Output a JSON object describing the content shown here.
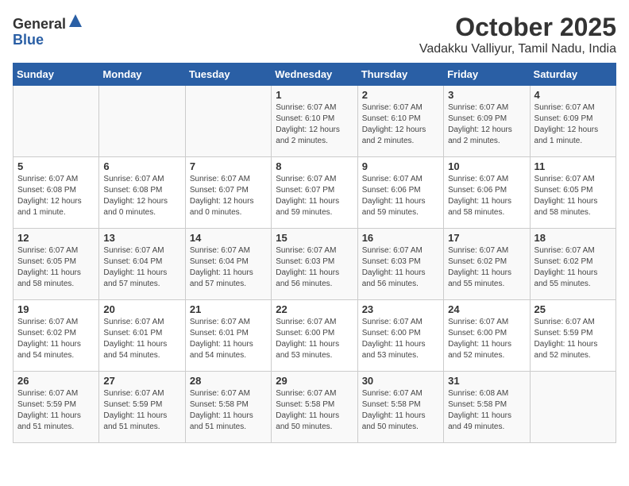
{
  "header": {
    "logo_general": "General",
    "logo_blue": "Blue",
    "title": "October 2025",
    "subtitle": "Vadakku Valliyur, Tamil Nadu, India"
  },
  "calendar": {
    "days_of_week": [
      "Sunday",
      "Monday",
      "Tuesday",
      "Wednesday",
      "Thursday",
      "Friday",
      "Saturday"
    ],
    "weeks": [
      [
        {
          "day": "",
          "info": ""
        },
        {
          "day": "",
          "info": ""
        },
        {
          "day": "",
          "info": ""
        },
        {
          "day": "1",
          "info": "Sunrise: 6:07 AM\nSunset: 6:10 PM\nDaylight: 12 hours and 2 minutes."
        },
        {
          "day": "2",
          "info": "Sunrise: 6:07 AM\nSunset: 6:10 PM\nDaylight: 12 hours and 2 minutes."
        },
        {
          "day": "3",
          "info": "Sunrise: 6:07 AM\nSunset: 6:09 PM\nDaylight: 12 hours and 2 minutes."
        },
        {
          "day": "4",
          "info": "Sunrise: 6:07 AM\nSunset: 6:09 PM\nDaylight: 12 hours and 1 minute."
        }
      ],
      [
        {
          "day": "5",
          "info": "Sunrise: 6:07 AM\nSunset: 6:08 PM\nDaylight: 12 hours and 1 minute."
        },
        {
          "day": "6",
          "info": "Sunrise: 6:07 AM\nSunset: 6:08 PM\nDaylight: 12 hours and 0 minutes."
        },
        {
          "day": "7",
          "info": "Sunrise: 6:07 AM\nSunset: 6:07 PM\nDaylight: 12 hours and 0 minutes."
        },
        {
          "day": "8",
          "info": "Sunrise: 6:07 AM\nSunset: 6:07 PM\nDaylight: 11 hours and 59 minutes."
        },
        {
          "day": "9",
          "info": "Sunrise: 6:07 AM\nSunset: 6:06 PM\nDaylight: 11 hours and 59 minutes."
        },
        {
          "day": "10",
          "info": "Sunrise: 6:07 AM\nSunset: 6:06 PM\nDaylight: 11 hours and 58 minutes."
        },
        {
          "day": "11",
          "info": "Sunrise: 6:07 AM\nSunset: 6:05 PM\nDaylight: 11 hours and 58 minutes."
        }
      ],
      [
        {
          "day": "12",
          "info": "Sunrise: 6:07 AM\nSunset: 6:05 PM\nDaylight: 11 hours and 58 minutes."
        },
        {
          "day": "13",
          "info": "Sunrise: 6:07 AM\nSunset: 6:04 PM\nDaylight: 11 hours and 57 minutes."
        },
        {
          "day": "14",
          "info": "Sunrise: 6:07 AM\nSunset: 6:04 PM\nDaylight: 11 hours and 57 minutes."
        },
        {
          "day": "15",
          "info": "Sunrise: 6:07 AM\nSunset: 6:03 PM\nDaylight: 11 hours and 56 minutes."
        },
        {
          "day": "16",
          "info": "Sunrise: 6:07 AM\nSunset: 6:03 PM\nDaylight: 11 hours and 56 minutes."
        },
        {
          "day": "17",
          "info": "Sunrise: 6:07 AM\nSunset: 6:02 PM\nDaylight: 11 hours and 55 minutes."
        },
        {
          "day": "18",
          "info": "Sunrise: 6:07 AM\nSunset: 6:02 PM\nDaylight: 11 hours and 55 minutes."
        }
      ],
      [
        {
          "day": "19",
          "info": "Sunrise: 6:07 AM\nSunset: 6:02 PM\nDaylight: 11 hours and 54 minutes."
        },
        {
          "day": "20",
          "info": "Sunrise: 6:07 AM\nSunset: 6:01 PM\nDaylight: 11 hours and 54 minutes."
        },
        {
          "day": "21",
          "info": "Sunrise: 6:07 AM\nSunset: 6:01 PM\nDaylight: 11 hours and 54 minutes."
        },
        {
          "day": "22",
          "info": "Sunrise: 6:07 AM\nSunset: 6:00 PM\nDaylight: 11 hours and 53 minutes."
        },
        {
          "day": "23",
          "info": "Sunrise: 6:07 AM\nSunset: 6:00 PM\nDaylight: 11 hours and 53 minutes."
        },
        {
          "day": "24",
          "info": "Sunrise: 6:07 AM\nSunset: 6:00 PM\nDaylight: 11 hours and 52 minutes."
        },
        {
          "day": "25",
          "info": "Sunrise: 6:07 AM\nSunset: 5:59 PM\nDaylight: 11 hours and 52 minutes."
        }
      ],
      [
        {
          "day": "26",
          "info": "Sunrise: 6:07 AM\nSunset: 5:59 PM\nDaylight: 11 hours and 51 minutes."
        },
        {
          "day": "27",
          "info": "Sunrise: 6:07 AM\nSunset: 5:59 PM\nDaylight: 11 hours and 51 minutes."
        },
        {
          "day": "28",
          "info": "Sunrise: 6:07 AM\nSunset: 5:58 PM\nDaylight: 11 hours and 51 minutes."
        },
        {
          "day": "29",
          "info": "Sunrise: 6:07 AM\nSunset: 5:58 PM\nDaylight: 11 hours and 50 minutes."
        },
        {
          "day": "30",
          "info": "Sunrise: 6:07 AM\nSunset: 5:58 PM\nDaylight: 11 hours and 50 minutes."
        },
        {
          "day": "31",
          "info": "Sunrise: 6:08 AM\nSunset: 5:58 PM\nDaylight: 11 hours and 49 minutes."
        },
        {
          "day": "",
          "info": ""
        }
      ]
    ]
  }
}
